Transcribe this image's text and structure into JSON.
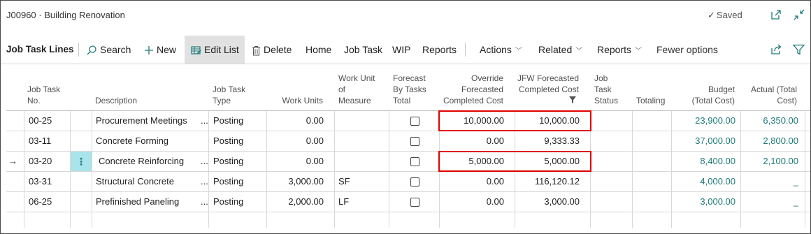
{
  "window": {
    "title": "J00960 · Building Renovation",
    "saved_label": "Saved"
  },
  "actionbar": {
    "section_title": "Job Task Lines",
    "search": "Search",
    "new": "New",
    "edit_list": "Edit List",
    "delete": "Delete",
    "home": "Home",
    "job_task": "Job Task",
    "wip": "WIP",
    "reports": "Reports",
    "actions": "Actions",
    "related": "Related",
    "reports_menu": "Reports",
    "fewer_options": "Fewer options"
  },
  "table": {
    "headers": {
      "job_task_no": [
        "Job Task",
        "No."
      ],
      "description": [
        "Description"
      ],
      "job_task_type": [
        "Job Task",
        "Type"
      ],
      "work_units": [
        "Work Units"
      ],
      "work_unit_of_measure": [
        "Work Unit",
        "of",
        "Measure"
      ],
      "forecast_by_tasks_total": [
        "Forecast",
        "By Tasks",
        "Total"
      ],
      "override_forecasted_completed_cost": [
        "Override",
        "Forecasted",
        "Completed Cost"
      ],
      "jfw_forecasted_completed_cost": [
        "JFW Forecasted",
        "Completed Cost"
      ],
      "job_task_status": [
        "Job",
        "Task",
        "Status"
      ],
      "totaling": [
        "Totaling"
      ],
      "budget_total_cost": [
        "Budget",
        "(Total Cost)"
      ],
      "actual_total_cost": [
        "Actual (Total",
        "Cost)"
      ]
    },
    "rows": [
      {
        "no": "00-25",
        "description": "Procurement Meetings",
        "ellipsis": "...",
        "type": "Posting",
        "work_units": "0.00",
        "uom": "",
        "override": "10,000.00",
        "jfw": "10,000.00",
        "budget": "23,900.00",
        "actual": "6,350.00"
      },
      {
        "no": "03-11",
        "description": "Concrete Forming",
        "ellipsis": "",
        "type": "Posting",
        "work_units": "0.00",
        "uom": "",
        "override": "0.00",
        "jfw": "9,333.33",
        "budget": "37,000.00",
        "actual": "2,800.00"
      },
      {
        "no": "03-20",
        "description": "Concrete Reinforcing",
        "ellipsis": "...",
        "type": "Posting",
        "work_units": "0.00",
        "uom": "",
        "override": "5,000.00",
        "jfw": "5,000.00",
        "budget": "8,400.00",
        "actual": "2,100.00"
      },
      {
        "no": "03-31",
        "description": "Structural Concrete",
        "ellipsis": "...",
        "type": "Posting",
        "work_units": "3,000.00",
        "uom": "SF",
        "override": "0.00",
        "jfw": "116,120.12",
        "budget": "4,000.00",
        "actual": "_"
      },
      {
        "no": "06-25",
        "description": "Prefinished Paneling",
        "ellipsis": "...",
        "type": "Posting",
        "work_units": "2,000.00",
        "uom": "LF",
        "override": "0.00",
        "jfw": "3,000.00",
        "budget": "3,000.00",
        "actual": "_"
      }
    ],
    "current_row_marker": "→",
    "row_menu_glyph": "⋮"
  }
}
